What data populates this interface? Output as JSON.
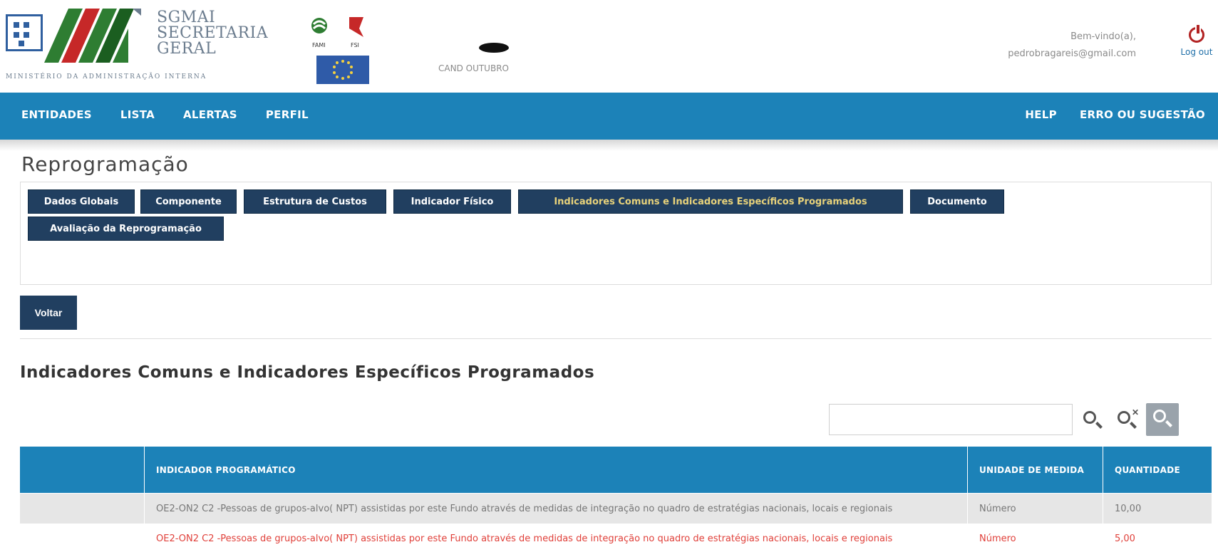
{
  "header": {
    "org_name": "SGMAI\nSECRETARIA\nGERAL",
    "org_line1": "SGMAI",
    "org_line2": "SECRETARIA",
    "org_line3": "GERAL",
    "ministry": "MINISTÉRIO DA ADMINISTRAÇÃO INTERNA",
    "fund_labels": [
      "FAMI",
      "FSI"
    ],
    "candidate": "CAND OUTUBRO",
    "welcome": "Bem-vindo(a),",
    "user_email": "pedrobragareis@gmail.com",
    "logout": "Log out"
  },
  "nav": {
    "left": [
      "ENTIDADES",
      "LISTA",
      "ALERTAS",
      "PERFIL"
    ],
    "right": [
      "HELP",
      "ERRO OU SUGESTÃO"
    ]
  },
  "page": {
    "title": "Reprogramação",
    "back_label": "Voltar",
    "section_title": "Indicadores Comuns e Indicadores Específicos Programados"
  },
  "tabs": [
    {
      "label": "Dados Globais"
    },
    {
      "label": "Componente"
    },
    {
      "label": "Estrutura de Custos"
    },
    {
      "label": "Indicador Físico"
    },
    {
      "label": "Indicadores Comuns e Indicadores Específicos Programados",
      "active": true
    },
    {
      "label": "Documento"
    },
    {
      "label": "Avaliação da Reprogramação"
    }
  ],
  "search": {
    "value": "",
    "placeholder": ""
  },
  "table": {
    "headers": [
      "",
      "INDICADOR PROGRAMÁTICO",
      "UNIDADE DE MEDIDA",
      "QUANTIDADE"
    ],
    "rows": [
      {
        "indicador": "OE2-ON2 C2 -Pessoas de grupos-alvo( NPT) assistidas por este Fundo através de medidas de integração no quadro de estratégias nacionais, locais e regionais",
        "unidade": "Número",
        "quantidade": "10,00"
      },
      {
        "indicador": "OE2-ON2 C2 -Pessoas de grupos-alvo( NPT) assistidas por este Fundo através de medidas de integração no quadro de estratégias nacionais, locais e regionais",
        "unidade": "Número",
        "quantidade": "5,00"
      }
    ]
  },
  "colors": {
    "nav_blue": "#1c82b8",
    "tab_navy": "#213f60",
    "active_tab_text": "#e8d27a",
    "highlight_red": "#e0403a",
    "logo_green": "#2e7d32",
    "logo_red": "#c62828"
  }
}
